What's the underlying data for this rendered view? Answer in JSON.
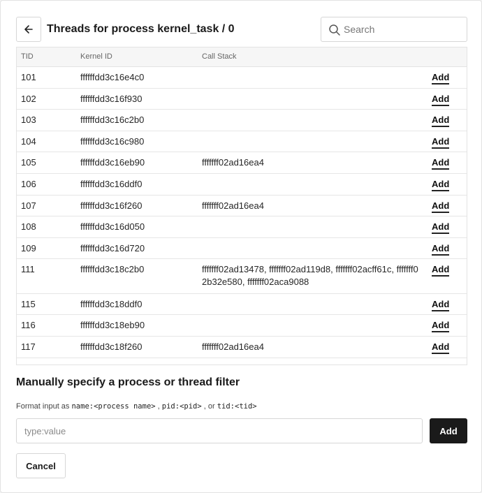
{
  "header": {
    "title": "Threads for process kernel_task / 0",
    "search_placeholder": "Search"
  },
  "table": {
    "columns": {
      "tid": "TID",
      "kernel_id": "Kernel ID",
      "call_stack": "Call Stack"
    },
    "add_label": "Add",
    "rows": [
      {
        "tid": "101",
        "kernel_id": "ffffffdd3c16e4c0",
        "call_stack": ""
      },
      {
        "tid": "102",
        "kernel_id": "ffffffdd3c16f930",
        "call_stack": ""
      },
      {
        "tid": "103",
        "kernel_id": "ffffffdd3c16c2b0",
        "call_stack": ""
      },
      {
        "tid": "104",
        "kernel_id": "ffffffdd3c16c980",
        "call_stack": ""
      },
      {
        "tid": "105",
        "kernel_id": "ffffffdd3c16eb90",
        "call_stack": "fffffff02ad16ea4"
      },
      {
        "tid": "106",
        "kernel_id": "ffffffdd3c16ddf0",
        "call_stack": ""
      },
      {
        "tid": "107",
        "kernel_id": "ffffffdd3c16f260",
        "call_stack": "fffffff02ad16ea4"
      },
      {
        "tid": "108",
        "kernel_id": "ffffffdd3c16d050",
        "call_stack": ""
      },
      {
        "tid": "109",
        "kernel_id": "ffffffdd3c16d720",
        "call_stack": ""
      },
      {
        "tid": "111",
        "kernel_id": "ffffffdd3c18c2b0",
        "call_stack": "fffffff02ad13478, fffffff02ad119d8, fffffff02acff61c, fffffff02b32e580, fffffff02aca9088"
      },
      {
        "tid": "115",
        "kernel_id": "ffffffdd3c18ddf0",
        "call_stack": ""
      },
      {
        "tid": "116",
        "kernel_id": "ffffffdd3c18eb90",
        "call_stack": ""
      },
      {
        "tid": "117",
        "kernel_id": "ffffffdd3c18f260",
        "call_stack": "fffffff02ad16ea4"
      }
    ]
  },
  "manual": {
    "title": "Manually specify a process or thread filter",
    "format_prefix": "Format input as",
    "format_name": "name:<process name>",
    "sep1": ",",
    "format_pid": "pid:<pid>",
    "sep2": ", or",
    "format_tid": "tid:<tid>",
    "input_placeholder": "type:value",
    "add_label": "Add"
  },
  "footer": {
    "cancel_label": "Cancel"
  },
  "colors": {
    "primary_button": "#1a1a1a",
    "border": "#d6d6d6",
    "header_bg": "#f6f6f6"
  }
}
